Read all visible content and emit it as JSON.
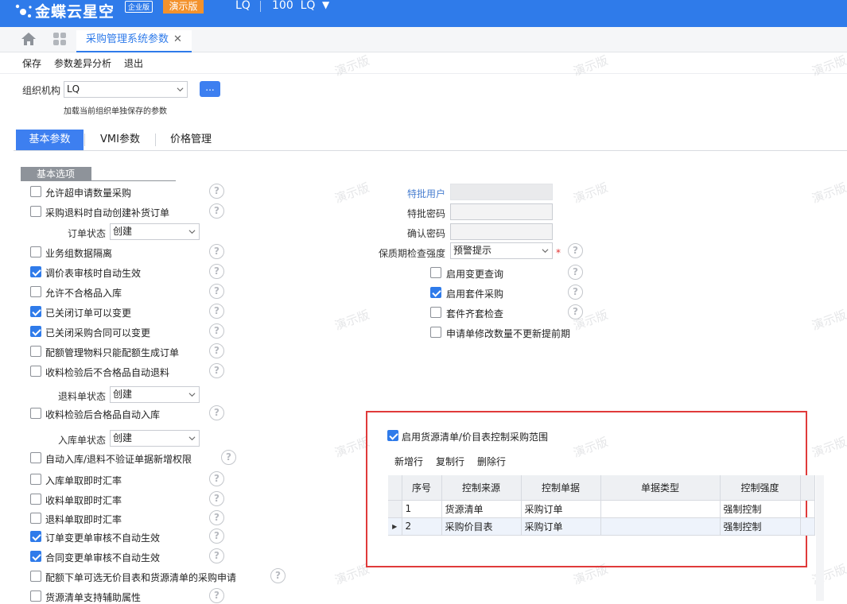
{
  "header": {
    "brand": "金蝶云星空",
    "edition": "企业版",
    "demo_badge": "演示版",
    "org": "LQ",
    "account": "100  LQ",
    "caret": "▼"
  },
  "doc_tab": {
    "label": "采购管理系统参数",
    "close": "✕"
  },
  "toolbar": {
    "save": "保存",
    "diff": "参数差异分析",
    "exit": "退出"
  },
  "org_row": {
    "label": "组织机构",
    "value": "LQ",
    "btn": "...",
    "hint": "加载当前组织单独保存的参数"
  },
  "settings_tabs": [
    "基本参数",
    "VMI参数",
    "价格管理"
  ],
  "group_title": "基本选项",
  "left_options": [
    {
      "label": "允许超申请数量采购",
      "checked": false
    },
    {
      "label": "采购退料时自动创建补货订单",
      "checked": false
    },
    {
      "label": "业务组数据隔离",
      "checked": false
    },
    {
      "label": "调价表审核时自动生效",
      "checked": true
    },
    {
      "label": "允许不合格品入库",
      "checked": false
    },
    {
      "label": "已关闭订单可以变更",
      "checked": true
    },
    {
      "label": "已关闭采购合同可以变更",
      "checked": true
    },
    {
      "label": "配额管理物料只能配额生成订单",
      "checked": false
    },
    {
      "label": "收料检验后不合格品自动退料",
      "checked": false
    },
    {
      "label": "收料检验后合格品自动入库",
      "checked": false
    },
    {
      "label": "自动入库/退料不验证单据新增权限",
      "checked": false
    },
    {
      "label": "入库单取即时汇率",
      "checked": false
    },
    {
      "label": "收料单取即时汇率",
      "checked": false
    },
    {
      "label": "退料单取即时汇率",
      "checked": false
    },
    {
      "label": "订单变更单审核不自动生效",
      "checked": true
    },
    {
      "label": "合同变更单审核不自动生效",
      "checked": true
    },
    {
      "label": "配额下单可选无价目表和货源清单的采购申请",
      "checked": false
    },
    {
      "label": "货源清单支持辅助属性",
      "checked": false
    }
  ],
  "selects": {
    "order_status": {
      "label": "订单状态",
      "value": "创建"
    },
    "return_status": {
      "label": "退料单状态",
      "value": "创建"
    },
    "inbound_status": {
      "label": "入库单状态",
      "value": "创建"
    }
  },
  "right": {
    "special_user": "特批用户",
    "special_pwd": "特批密码",
    "confirm_pwd": "确认密码",
    "shelf_label": "保质期检查强度",
    "shelf_value": "预警提示",
    "required": "*",
    "options": [
      {
        "label": "启用变更查询",
        "checked": false
      },
      {
        "label": "启用套件采购",
        "checked": true
      },
      {
        "label": "套件齐套检查",
        "checked": false
      },
      {
        "label": "申请单修改数量不更新提前期",
        "checked": false
      }
    ]
  },
  "panel": {
    "enable": {
      "label": "启用货源清单/价目表控制采购范围",
      "checked": true
    },
    "grid_buttons": [
      "新增行",
      "复制行",
      "删除行"
    ],
    "columns": [
      "序号",
      "控制来源",
      "控制单据",
      "单据类型",
      "控制强度"
    ],
    "rows": [
      {
        "seq": "1",
        "source": "货源清单",
        "doc": "采购订单",
        "type": "",
        "strength": "强制控制"
      },
      {
        "seq": "2",
        "source": "采购价目表",
        "doc": "采购订单",
        "type": "",
        "strength": "强制控制"
      }
    ]
  },
  "watermark": "演示版",
  "help_glyph": "?"
}
